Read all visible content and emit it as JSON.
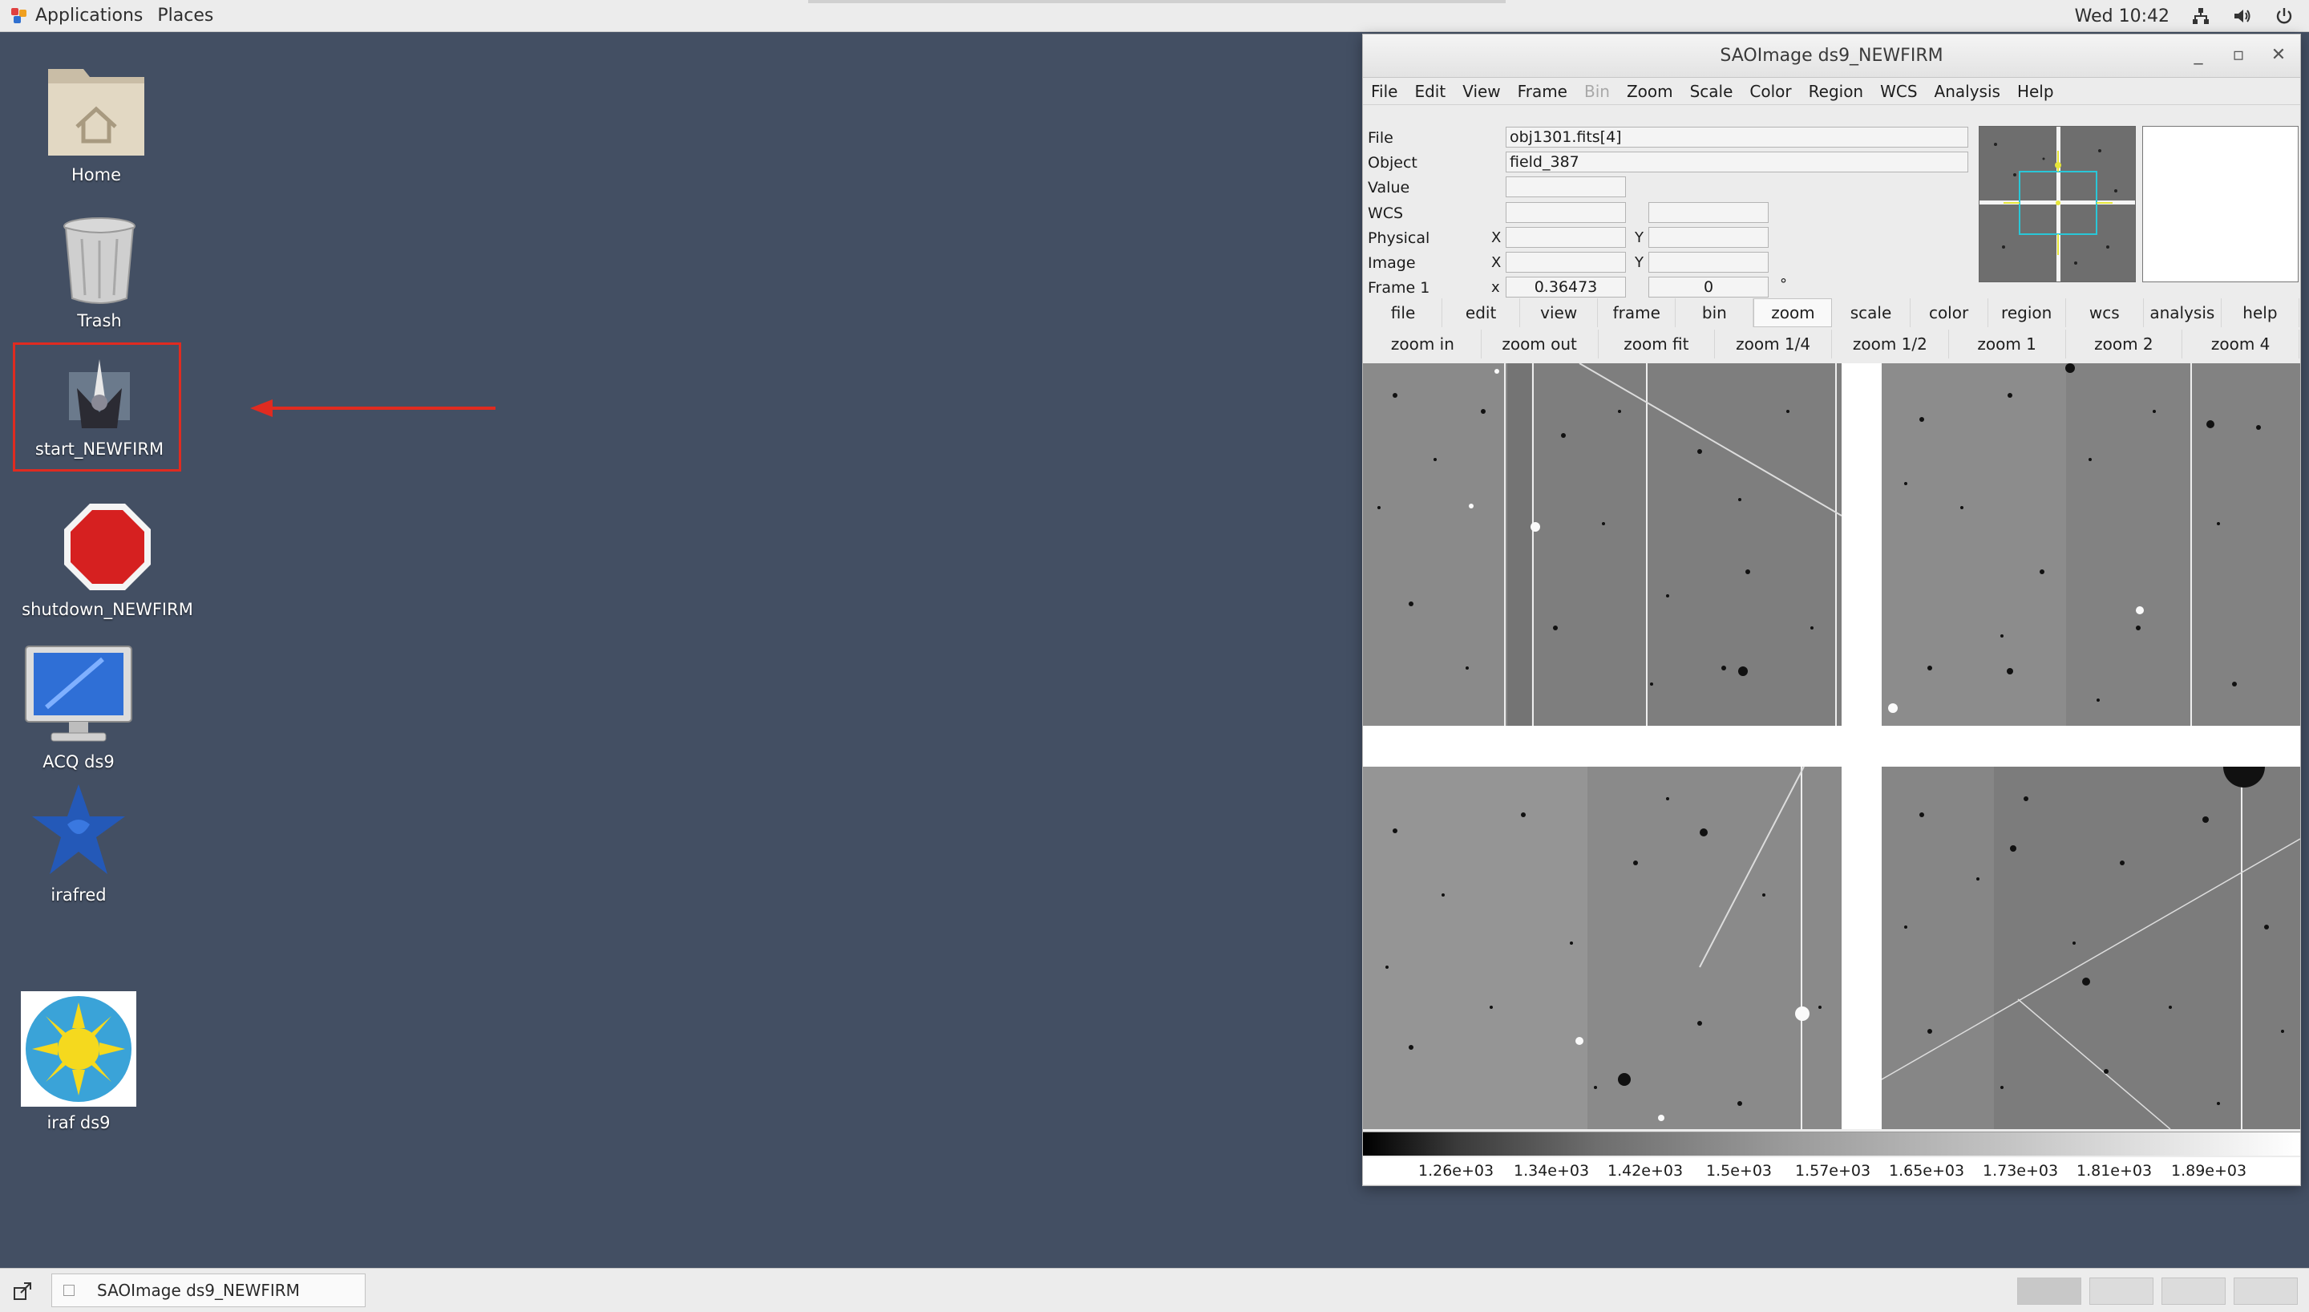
{
  "topbar": {
    "applications": "Applications",
    "places": "Places",
    "clock": "Wed 10:42",
    "icons": [
      "network-icon",
      "volume-icon",
      "power-icon"
    ]
  },
  "desktop": {
    "icons": [
      {
        "label": "Home",
        "icon": "home-folder-icon"
      },
      {
        "label": "Trash",
        "icon": "trash-icon"
      },
      {
        "label": "start_NEWFIRM",
        "icon": "telescope-icon"
      },
      {
        "label": "shutdown_NEWFIRM",
        "icon": "stop-sign-icon"
      },
      {
        "label": "ACQ ds9",
        "icon": "monitor-icon"
      },
      {
        "label": "irafred",
        "icon": "iraf-star-icon"
      },
      {
        "label": "iraf ds9",
        "icon": "sun-icon"
      }
    ],
    "highlight_color": "#e02b20"
  },
  "ds9": {
    "title": "SAOImage ds9_NEWFIRM",
    "menu": [
      "File",
      "Edit",
      "View",
      "Frame",
      "Bin",
      "Zoom",
      "Scale",
      "Color",
      "Region",
      "WCS",
      "Analysis",
      "Help"
    ],
    "info": {
      "file_label": "File",
      "file_value": "obj1301.fits[4]",
      "object_label": "Object",
      "object_value": "field_387",
      "value_label": "Value",
      "wcs_label": "WCS",
      "physical_label": "Physical",
      "image_label": "Image",
      "frame_label": "Frame 1",
      "x_label": "X",
      "y_label": "Y",
      "frame_x_label": "x",
      "frame_zoom": "0.36473",
      "frame_angle": "0",
      "degree_symbol": "°"
    },
    "buttons": [
      "file",
      "edit",
      "view",
      "frame",
      "bin",
      "zoom",
      "scale",
      "color",
      "region",
      "wcs",
      "analysis",
      "help"
    ],
    "active_button": "zoom",
    "zoom_buttons": [
      "zoom in",
      "zoom out",
      "zoom fit",
      "zoom 1/4",
      "zoom 1/2",
      "zoom 1",
      "zoom 2",
      "zoom 4"
    ],
    "colorbar_labels": [
      "1.26e+03",
      "1.34e+03",
      "1.42e+03",
      "1.5e+03",
      "1.57e+03",
      "1.65e+03",
      "1.73e+03",
      "1.81e+03",
      "1.89e+03"
    ]
  },
  "taskbar": {
    "task_label": "SAOImage ds9_NEWFIRM"
  }
}
